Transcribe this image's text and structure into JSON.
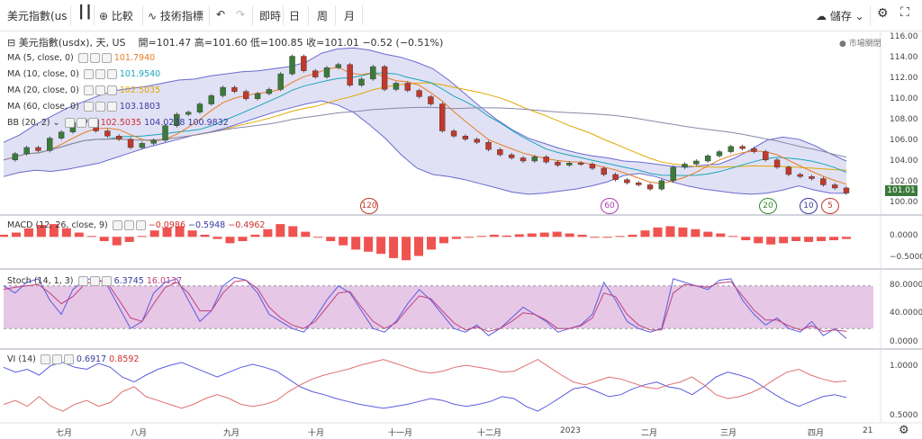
{
  "toolbar": {
    "symbol": "美元指數(us",
    "compare": "比較",
    "indicators": "技術指標",
    "undo_icon": "undo-icon",
    "redo_icon": "redo-icon",
    "timeframes": [
      "即時",
      "日",
      "周",
      "月"
    ],
    "save": "儲存"
  },
  "main": {
    "title": "美元指數(usdx), 天, US",
    "ohlc": "開=101.47  高=101.60  低=100.85  收=101.01  −0.52 (−0.51%)",
    "market_status": "市場關閉",
    "last_price": "101.01",
    "indicators": [
      {
        "name": "MA (5, close, 0)",
        "value": "101.7940",
        "color": "#e67e22"
      },
      {
        "name": "MA (10, close, 0)",
        "value": "101.9540",
        "color": "#1aa6b7"
      },
      {
        "name": "MA (20, close, 0)",
        "value": "102.5035",
        "color": "#e0a800"
      },
      {
        "name": "MA (60, close, 0)",
        "value": "103.1803",
        "color": "#3a3aa0"
      }
    ],
    "bb": {
      "name": "BB (20, 2)",
      "v1": "102.5035",
      "v2": "104.0238",
      "v3": "100.9832"
    },
    "badges": [
      "120",
      "60",
      "20",
      "10",
      "5"
    ]
  },
  "macd": {
    "name": "MACD (12, 26, close, 9)",
    "v1": "−0.0986",
    "v2": "−0.5948",
    "v3": "−0.4962"
  },
  "stoch": {
    "name": "Stoch (14, 1, 3)",
    "v1": "6.3745",
    "v2": "16.0137"
  },
  "vi": {
    "name": "VI (14)",
    "v1": "0.6917",
    "v2": "0.8592"
  },
  "x_axis": [
    "七月",
    "八月",
    "九月",
    "十月",
    "十一月",
    "十二月",
    "2023",
    "二月",
    "三月",
    "四月",
    "21"
  ],
  "chart_data": [
    {
      "type": "candlestick",
      "y_ticks": [
        "116.00",
        "114.00",
        "112.00",
        "110.00",
        "108.00",
        "106.00",
        "104.00",
        "102.00",
        "100.00"
      ],
      "ylim": [
        99.5,
        116.5
      ],
      "close": [
        104.2,
        104.8,
        105.4,
        105.1,
        106.3,
        106.9,
        107.8,
        108.1,
        107.0,
        106.5,
        106.2,
        105.4,
        105.8,
        106.1,
        107.5,
        108.6,
        108.8,
        109.6,
        110.4,
        111.2,
        110.8,
        110.1,
        110.6,
        111.0,
        112.5,
        114.2,
        112.8,
        112.2,
        113.1,
        113.4,
        111.4,
        112.0,
        113.2,
        111.0,
        111.6,
        110.9,
        110.3,
        109.6,
        107.0,
        106.5,
        106.2,
        105.9,
        105.2,
        104.7,
        104.4,
        104.1,
        104.5,
        104.0,
        103.7,
        103.9,
        103.8,
        103.4,
        102.8,
        102.3,
        102.0,
        101.8,
        101.4,
        102.2,
        103.5,
        103.8,
        104.1,
        104.6,
        105.0,
        105.5,
        105.3,
        105.0,
        104.2,
        103.5,
        102.8,
        102.6,
        102.4,
        101.8,
        101.5,
        101.01
      ],
      "upper": [
        105.9,
        106.6,
        107.6,
        108.4,
        109.2,
        109.8,
        110.4,
        110.9,
        111.1,
        111.3,
        111.6,
        111.9,
        112.0,
        112.3,
        112.5,
        112.7,
        112.8,
        113.0,
        113.2,
        113.6,
        114.5,
        114.9,
        115.0,
        114.8,
        114.4,
        114.1,
        113.6,
        113.0,
        111.9,
        110.6,
        109.3,
        108.1,
        107.1,
        106.3,
        105.8,
        105.3,
        104.9,
        104.6,
        104.4,
        104.1,
        104.0,
        103.8,
        103.6,
        103.5,
        103.7,
        103.8,
        104.4,
        105.2,
        106.1,
        106.4,
        106.2,
        105.6,
        104.8,
        104.1
      ],
      "lower": [
        102.6,
        103.0,
        103.2,
        103.1,
        103.3,
        103.6,
        103.9,
        104.4,
        104.9,
        105.4,
        105.8,
        106.2,
        106.6,
        106.9,
        107.3,
        107.8,
        108.3,
        108.8,
        109.2,
        109.6,
        109.9,
        109.5,
        108.8,
        107.6,
        106.3,
        104.7,
        103.4,
        102.8,
        102.6,
        102.3,
        101.9,
        101.5,
        101.1,
        100.9,
        101.0,
        101.2,
        101.4,
        101.7,
        102.1,
        102.7,
        102.9,
        102.6,
        102.1,
        101.7,
        101.4,
        101.2,
        101.0,
        100.9,
        101.0,
        101.3,
        101.7,
        101.3,
        101.0,
        100.98
      ]
    },
    {
      "type": "bar",
      "y_ticks": [
        "0.0000",
        "−0.5000"
      ],
      "ylim": [
        -0.65,
        0.45
      ],
      "histogram": [
        0.05,
        0.1,
        0.2,
        0.28,
        0.3,
        0.2,
        0.1,
        0.02,
        -0.1,
        -0.2,
        -0.12,
        0.02,
        0.15,
        0.22,
        0.25,
        0.15,
        0.05,
        -0.05,
        -0.15,
        -0.1,
        0.05,
        0.18,
        0.3,
        0.25,
        0.12,
        0.0,
        -0.1,
        -0.2,
        -0.3,
        -0.35,
        -0.4,
        -0.5,
        -0.55,
        -0.45,
        -0.3,
        -0.15,
        -0.05,
        -0.02,
        0.02,
        0.05,
        0.03,
        0.06,
        0.08,
        0.1,
        0.12,
        0.08,
        0.05,
        0.0,
        -0.02,
        0.02,
        0.05,
        0.15,
        0.22,
        0.25,
        0.22,
        0.18,
        0.12,
        0.08,
        0.02,
        -0.08,
        -0.15,
        -0.18,
        -0.15,
        -0.1,
        -0.12,
        -0.1,
        -0.08,
        -0.05
      ]
    },
    {
      "type": "line",
      "y_ticks": [
        "80.0000",
        "40.0000",
        "0.0000"
      ],
      "ylim": [
        -5,
        100
      ],
      "band": [
        20,
        80
      ],
      "series": [
        {
          "values": [
            80,
            70,
            85,
            90,
            60,
            40,
            75,
            88,
            92,
            80,
            50,
            20,
            30,
            70,
            85,
            90,
            60,
            30,
            45,
            80,
            92,
            88,
            70,
            40,
            30,
            20,
            15,
            35,
            60,
            80,
            70,
            45,
            20,
            15,
            30,
            55,
            75,
            60,
            40,
            20,
            15,
            25,
            10,
            20,
            35,
            50,
            40,
            30,
            15,
            20,
            25,
            40,
            85,
            60,
            30,
            20,
            15,
            20,
            90,
            85,
            80,
            75,
            88,
            90,
            60,
            40,
            25,
            35,
            20,
            15,
            30,
            10,
            20,
            6
          ],
          "color": "#5b5be0"
        },
        {
          "values": [
            75,
            78,
            80,
            82,
            70,
            55,
            65,
            82,
            88,
            84,
            60,
            35,
            30,
            55,
            78,
            85,
            70,
            45,
            45,
            70,
            86,
            88,
            76,
            50,
            35,
            25,
            20,
            30,
            50,
            70,
            72,
            50,
            30,
            20,
            28,
            48,
            66,
            62,
            45,
            28,
            18,
            22,
            16,
            20,
            30,
            42,
            40,
            32,
            20,
            20,
            24,
            35,
            70,
            65,
            40,
            25,
            18,
            18,
            70,
            82,
            80,
            78,
            84,
            86,
            66,
            46,
            32,
            32,
            24,
            18,
            24,
            16,
            18,
            16
          ],
          "color": "#c04080"
        }
      ]
    },
    {
      "type": "line",
      "y_ticks": [
        "1.0000",
        "0.5000"
      ],
      "ylim": [
        0.45,
        1.15
      ],
      "series": [
        {
          "values": [
            1.0,
            0.95,
            0.98,
            0.92,
            1.02,
            1.05,
            1.0,
            0.98,
            1.04,
            1.0,
            0.9,
            0.85,
            0.92,
            0.98,
            1.02,
            1.05,
            1.0,
            0.95,
            0.9,
            0.95,
            1.0,
            1.03,
            1.0,
            0.96,
            0.88,
            0.8,
            0.75,
            0.72,
            0.68,
            0.65,
            0.62,
            0.6,
            0.58,
            0.6,
            0.62,
            0.65,
            0.68,
            0.66,
            0.62,
            0.6,
            0.62,
            0.65,
            0.7,
            0.68,
            0.6,
            0.55,
            0.62,
            0.7,
            0.78,
            0.8,
            0.75,
            0.7,
            0.72,
            0.78,
            0.82,
            0.85,
            0.8,
            0.78,
            0.72,
            0.8,
            0.9,
            0.95,
            0.92,
            0.88,
            0.8,
            0.72,
            0.65,
            0.6,
            0.65,
            0.7,
            0.72,
            0.69
          ],
          "color": "#5b5be0"
        },
        {
          "values": [
            0.62,
            0.66,
            0.6,
            0.7,
            0.6,
            0.55,
            0.62,
            0.66,
            0.6,
            0.64,
            0.75,
            0.8,
            0.7,
            0.66,
            0.62,
            0.58,
            0.62,
            0.68,
            0.72,
            0.68,
            0.62,
            0.6,
            0.62,
            0.66,
            0.75,
            0.82,
            0.88,
            0.92,
            0.95,
            0.98,
            1.02,
            1.05,
            1.08,
            1.04,
            1.0,
            0.96,
            0.94,
            0.96,
            1.0,
            1.02,
            1.0,
            0.98,
            0.95,
            0.96,
            1.02,
            1.08,
            1.0,
            0.92,
            0.85,
            0.82,
            0.86,
            0.9,
            0.88,
            0.84,
            0.8,
            0.78,
            0.82,
            0.85,
            0.9,
            0.82,
            0.72,
            0.68,
            0.7,
            0.74,
            0.8,
            0.88,
            0.95,
            0.98,
            0.92,
            0.88,
            0.85,
            0.86
          ],
          "color": "#e07070"
        }
      ]
    }
  ]
}
